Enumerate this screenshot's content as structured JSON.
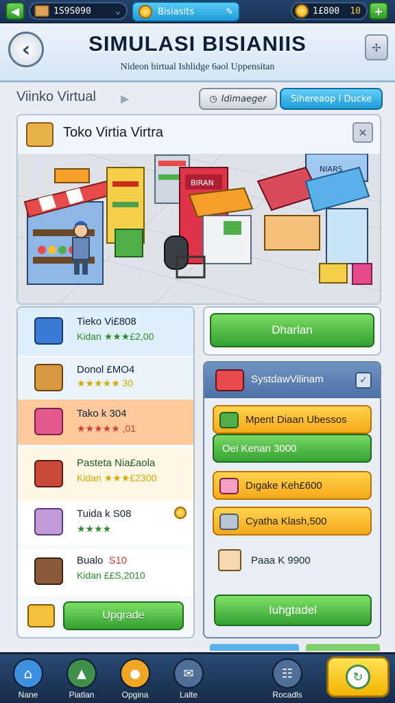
{
  "topbar": {
    "currency": "1S9S090",
    "tab_label": "Bisiasits",
    "coins": "1£800",
    "coins_suffix": "10",
    "left_button": "◀",
    "plus_button": "+"
  },
  "header": {
    "title": "SIMULASI BISIANIIS",
    "subtitle": "Nideon birtual Ishlidge 6aol Uppensitan"
  },
  "section": {
    "label": "Viinko Virtual",
    "chip_grey": "Idimaeger",
    "chip_blue": "Sihereaop I Ducke"
  },
  "shop": {
    "title": "Toko Virtia Virtra",
    "scene_signs": [
      "",
      "BIRAN",
      "",
      "NIARS"
    ]
  },
  "left_items": [
    {
      "name": "Tieko Vi£808",
      "price": "Kidan ★★★£2,00",
      "bg": "#dff0fb",
      "icon": "#3a7bd5"
    },
    {
      "name": "Donol £MO4",
      "price": "★★★★★ 30",
      "bg": "#e9f4fb",
      "icon": "#d89a40"
    },
    {
      "name": "Tako k 304",
      "price": "★★★★★ ,01",
      "bg": "#ffc99a",
      "icon": "#e25a8c"
    },
    {
      "name": "Pasteta Nia£aola",
      "price": "Kidan ★★★£2300",
      "bg": "#fdf7e4",
      "icon": "#c94a3a"
    },
    {
      "name": "Tuida k S08",
      "price": "★★★★",
      "bg": "#ffffff",
      "icon": "#c19ad8"
    },
    {
      "name": "Bualo",
      "name_extra": "S10",
      "price": "Kidan ££S,2010",
      "bg": "#ffffff",
      "icon": "#8a5a3a"
    }
  ],
  "left_upgrade": "Upgrade",
  "right_top_button": "Dharlan",
  "right_panel": {
    "title": "SystdawVilinam",
    "tasks": [
      {
        "label": "Mpent Diaan Ubessos",
        "style": "orange"
      },
      {
        "label": "Oei Kenan 3000",
        "style": "green"
      },
      {
        "label": "Dıgake Keh£600",
        "style": "orange"
      },
      {
        "label": "Cyatha Klash,500",
        "style": "orange"
      }
    ],
    "plain_task": "Paaa K 9900",
    "upgrade": "Iuhgtadel"
  },
  "bottom_nav": [
    {
      "label": "Nane",
      "color": "#3f8fe0"
    },
    {
      "label": "Piatlan",
      "color": "#3f8f4a"
    },
    {
      "label": "Opgina",
      "color": "#f0a622"
    },
    {
      "label": "Lalte",
      "color": "#4f6f96"
    },
    {
      "label": "Rocadls",
      "color": "#4f6f96"
    }
  ],
  "colors": {
    "accent_green": "#35a331",
    "accent_blue": "#1f9bd9",
    "accent_orange": "#f5a91a",
    "nav_bg": "#1b3556"
  }
}
